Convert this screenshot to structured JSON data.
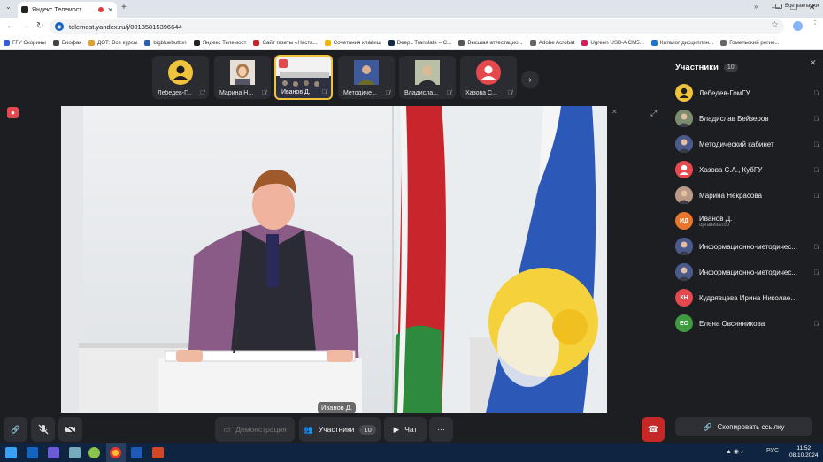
{
  "browser": {
    "tab_title": "Яндекс Телемост",
    "url": "telemost.yandex.ru/j/00135815396644",
    "bookmarks": [
      {
        "label": "ГГУ Скорины",
        "color": "#3b5bdb"
      },
      {
        "label": "Биофак",
        "color": "#444444"
      },
      {
        "label": "ДОТ: Все курсы",
        "color": "#e0a030"
      },
      {
        "label": "bigbluebutton",
        "color": "#2b5fb3"
      },
      {
        "label": "Яндекс Телемост",
        "color": "#222222"
      },
      {
        "label": "Сайт газеты «Наста...",
        "color": "#c62828"
      },
      {
        "label": "Сочетания клавиш",
        "color": "#f4b400"
      },
      {
        "label": "DeepL Translate – С...",
        "color": "#0f2b46"
      },
      {
        "label": "Высшая аттестацио...",
        "color": "#555555"
      },
      {
        "label": "Adobe Acrobat",
        "color": "#666666"
      },
      {
        "label": "Ugreen USB-A CM5...",
        "color": "#d81b60"
      },
      {
        "label": "Каталог дисциплин...",
        "color": "#1976d2"
      },
      {
        "label": "Гомельский регио...",
        "color": "#666666"
      }
    ],
    "bookmarks_folder": "Все закладки"
  },
  "thumbnails": [
    {
      "label": "Лебедев-Г...",
      "type": "avatar-yellow"
    },
    {
      "label": "Марина Н...",
      "type": "photo-woman"
    },
    {
      "label": "Иванов Д.",
      "type": "screen",
      "active": true
    },
    {
      "label": "Методиче...",
      "type": "photo-man"
    },
    {
      "label": "Владисла...",
      "type": "photo-man2"
    },
    {
      "label": "Хазова С...",
      "type": "avatar-red"
    }
  ],
  "video": {
    "speaker_name": "Иванов Д."
  },
  "controls": {
    "demo_label": "Демонстрация",
    "participants_label": "Участники",
    "participants_count": "10",
    "chat_label": "Чат",
    "more_label": "⋯"
  },
  "panel": {
    "title": "Участники",
    "count": "10",
    "copy_link_label": "Скопировать ссылку",
    "participants": [
      {
        "name": "Лебедев-ГомГУ",
        "avatar": "person",
        "color": "#f0c33c",
        "sub": ""
      },
      {
        "name": "Владислав Бейзеров",
        "avatar": "photo",
        "color": "#7a8b6e",
        "sub": ""
      },
      {
        "name": "Методический кабинет",
        "avatar": "photo",
        "color": "#4a5a8a",
        "sub": ""
      },
      {
        "name": "Хазова С.А., КубГУ",
        "avatar": "person",
        "color": "#e5484d",
        "sub": ""
      },
      {
        "name": "Марина Некрасова",
        "avatar": "photo",
        "color": "#b99a86",
        "sub": ""
      },
      {
        "name": "Иванов Д.",
        "avatar": "initials",
        "initials": "ИД",
        "color": "#e8762d",
        "sub": "организатор"
      },
      {
        "name": "Информационно-методичес...",
        "avatar": "photo",
        "color": "#4a5a8a",
        "sub": ""
      },
      {
        "name": "Информационно-методичес...",
        "avatar": "photo",
        "color": "#4a5a8a",
        "sub": ""
      },
      {
        "name": "Кудрявцева Ирина Николаев...",
        "avatar": "initials",
        "initials": "КН",
        "color": "#e5484d",
        "sub": ""
      },
      {
        "name": "Елена Овсянникова",
        "avatar": "initials",
        "initials": "ЕО",
        "color": "#3f9b3f",
        "sub": ""
      }
    ]
  },
  "taskbar": {
    "lang": "РУС",
    "time": "11:52",
    "date": "08.10.2024"
  }
}
